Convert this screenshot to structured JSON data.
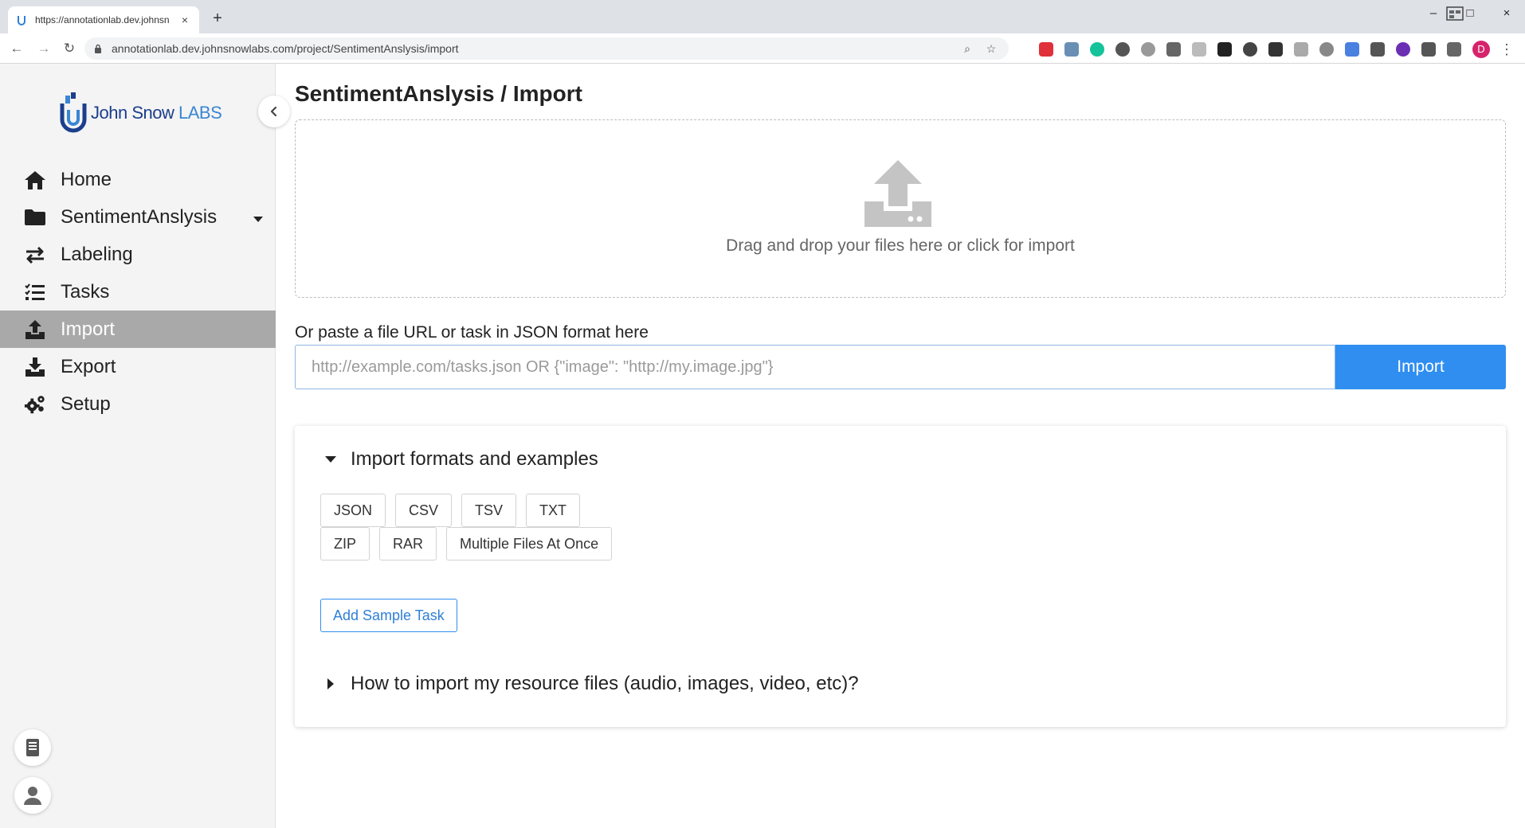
{
  "browser": {
    "tab_title": "https://annotationlab.dev.johnsn",
    "tab_close": "×",
    "new_tab": "+",
    "url": "annotationlab.dev.johnsnowlabs.com/project/SentimentAnslysis/import",
    "profile_initial": "D",
    "window_controls": {
      "minimize": "–",
      "maximize": "□",
      "close": "×"
    }
  },
  "sidebar": {
    "logo": {
      "brand": "John Snow",
      "labs": "LABS"
    },
    "items": [
      {
        "label": "Home",
        "icon": "home-icon"
      },
      {
        "label": "SentimentAnslysis",
        "icon": "folder-icon",
        "has_dropdown": true
      },
      {
        "label": "Labeling",
        "icon": "exchange-arrows-icon"
      },
      {
        "label": "Tasks",
        "icon": "task-list-icon"
      },
      {
        "label": "Import",
        "icon": "upload-icon",
        "active": true
      },
      {
        "label": "Export",
        "icon": "download-icon"
      },
      {
        "label": "Setup",
        "icon": "gears-icon"
      }
    ]
  },
  "page": {
    "project": "SentimentAnslysis",
    "separator": " / ",
    "section": "Import"
  },
  "dropzone": {
    "text": "Drag and drop your files here or click for import"
  },
  "paste": {
    "label": "Or paste a file URL or task in JSON format here",
    "placeholder": "http://example.com/tasks.json OR {\"image\": \"http://my.image.jpg\"}",
    "value": "",
    "button": "Import"
  },
  "formats": {
    "title": "Import formats and examples",
    "row1": [
      "JSON",
      "CSV",
      "TSV",
      "TXT"
    ],
    "row2": [
      "ZIP",
      "RAR",
      "Multiple Files At Once"
    ],
    "sample_button": "Add Sample Task",
    "resources_title": "How to import my resource files (audio, images, video, etc)?"
  },
  "colors": {
    "accent": "#2f8ef0",
    "active_nav_bg": "#a9a9a9",
    "sidebar_bg": "#f4f4f4"
  }
}
